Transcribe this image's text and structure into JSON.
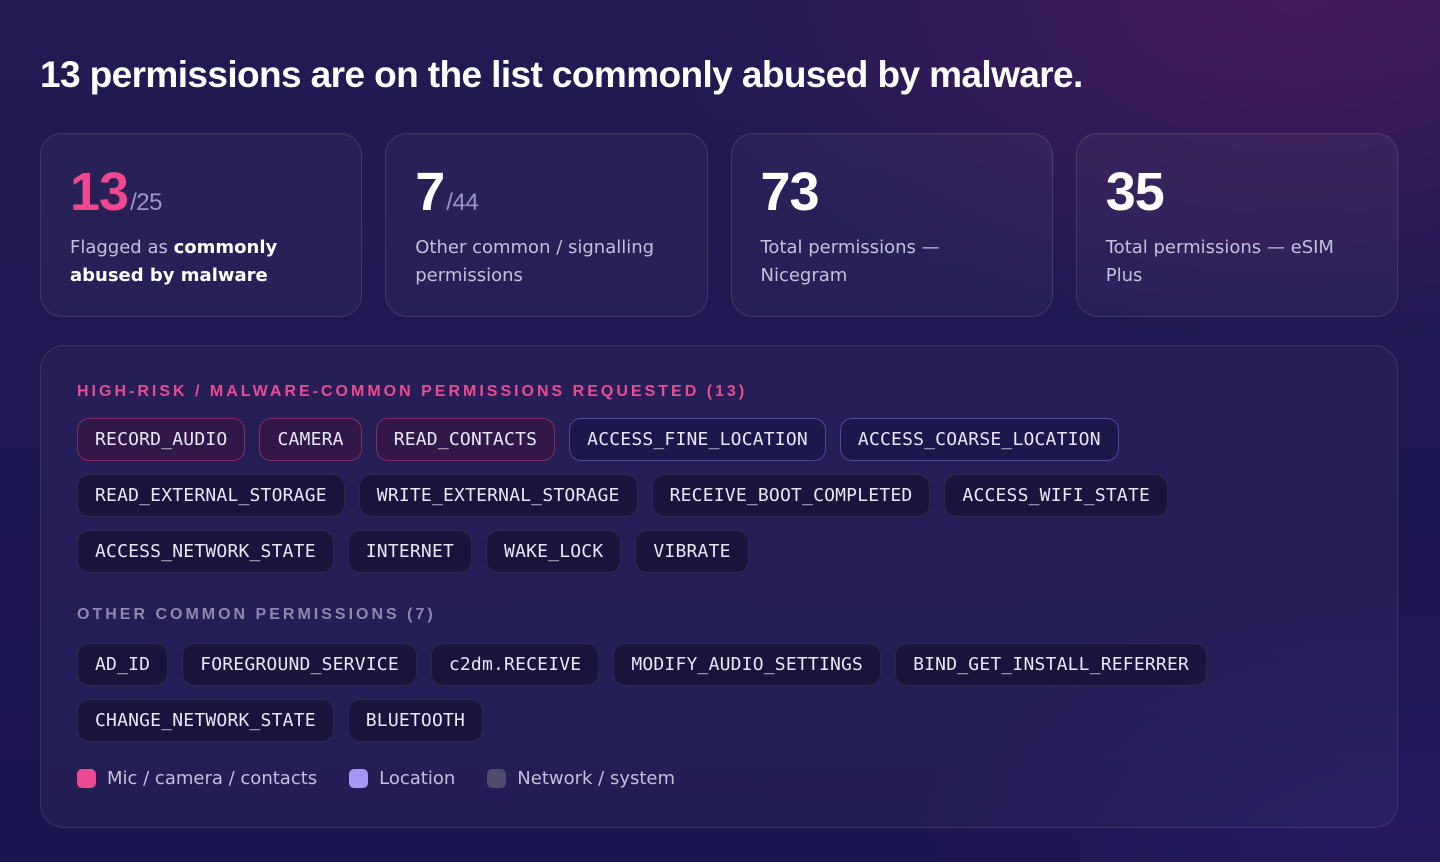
{
  "headline": "13 permissions are on the list commonly abused by malware.",
  "stats": [
    {
      "value": "13",
      "denominator": "/25",
      "label_parts": [
        "Flagged as ",
        "commonly abused by malware"
      ],
      "accent": "#f0488e"
    },
    {
      "value": "7",
      "denominator": "/44",
      "label": "Other common / signalling permissions"
    },
    {
      "value": "73",
      "denominator": "",
      "label": "Total permissions — Nicegram"
    },
    {
      "value": "35",
      "denominator": "",
      "label": "Total permissions — eSIM Plus"
    }
  ],
  "high_risk": {
    "title": "HIGH-RISK / MALWARE-COMMON PERMISSIONS REQUESTED (13)",
    "rows": [
      [
        {
          "label": "RECORD_AUDIO",
          "category": "mic"
        },
        {
          "label": "CAMERA",
          "category": "mic"
        },
        {
          "label": "READ_CONTACTS",
          "category": "mic"
        },
        {
          "label": "ACCESS_FINE_LOCATION",
          "category": "loc"
        },
        {
          "label": "ACCESS_COARSE_LOCATION",
          "category": "loc"
        }
      ],
      [
        {
          "label": "READ_EXTERNAL_STORAGE",
          "category": "net"
        },
        {
          "label": "WRITE_EXTERNAL_STORAGE",
          "category": "net"
        },
        {
          "label": "RECEIVE_BOOT_COMPLETED",
          "category": "net"
        },
        {
          "label": "ACCESS_WIFI_STATE",
          "category": "net"
        }
      ],
      [
        {
          "label": "ACCESS_NETWORK_STATE",
          "category": "net"
        },
        {
          "label": "INTERNET",
          "category": "net"
        },
        {
          "label": "WAKE_LOCK",
          "category": "net"
        },
        {
          "label": "VIBRATE",
          "category": "net"
        }
      ]
    ]
  },
  "other": {
    "title": "OTHER COMMON PERMISSIONS (7)",
    "rows": [
      [
        {
          "label": "AD_ID",
          "category": "other"
        },
        {
          "label": "FOREGROUND_SERVICE",
          "category": "other"
        },
        {
          "label": "c2dm.RECEIVE",
          "category": "other"
        },
        {
          "label": "MODIFY_AUDIO_SETTINGS",
          "category": "other"
        },
        {
          "label": "BIND_GET_INSTALL_REFERRER",
          "category": "other"
        }
      ],
      [
        {
          "label": "CHANGE_NETWORK_STATE",
          "category": "other"
        },
        {
          "label": "BLUETOOTH",
          "category": "other"
        }
      ]
    ]
  },
  "legend": [
    {
      "label": "Mic / camera / contacts",
      "color": "#ec4b92"
    },
    {
      "label": "Location",
      "color": "#a896f5"
    },
    {
      "label": "Network / system",
      "color": "#4f4a6e"
    }
  ]
}
